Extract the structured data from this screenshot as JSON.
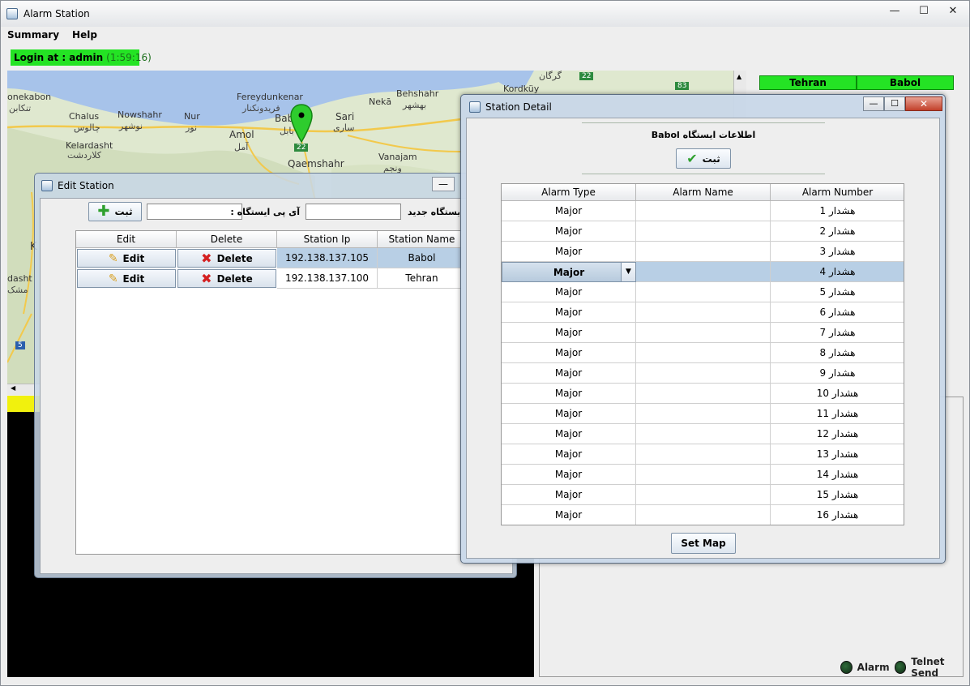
{
  "window": {
    "title": "Alarm Station",
    "controls": {
      "minimize": "—",
      "maximize": "☐",
      "close": "✕"
    }
  },
  "menu": {
    "items": [
      "Summary",
      "Help"
    ]
  },
  "login": {
    "text": "Login at : admin",
    "timer": "(1:59:16)"
  },
  "map": {
    "labels": [
      {
        "text": "onekabon"
      },
      {
        "text": "تنکابن"
      },
      {
        "text": "Chalus"
      },
      {
        "text": "چالوس"
      },
      {
        "text": "Nowshahr"
      },
      {
        "text": "نوشهر"
      },
      {
        "text": "Nur"
      },
      {
        "text": "نور"
      },
      {
        "text": "Kelardasht"
      },
      {
        "text": "کلاردشت"
      },
      {
        "text": "Fereydunkenar"
      },
      {
        "text": "فریدونکنار"
      },
      {
        "text": "Amol"
      },
      {
        "text": "آمل"
      },
      {
        "text": "Bab"
      },
      {
        "text": "بابل"
      },
      {
        "text": "Sari"
      },
      {
        "text": "ساری"
      },
      {
        "text": "Nekā"
      },
      {
        "text": "Behshahr"
      },
      {
        "text": "بهشهر"
      },
      {
        "text": "Qaemshahr"
      },
      {
        "text": "Vanajam"
      },
      {
        "text": "ونجم"
      },
      {
        "text": "گرگان"
      },
      {
        "text": "Kordküy"
      },
      {
        "text": "dasht"
      },
      {
        "text": "مشک"
      },
      {
        "text": "K"
      }
    ],
    "road_shields": [
      "22",
      "22",
      "83",
      "5"
    ]
  },
  "stations": {
    "badges": [
      "Tehran",
      "Babol"
    ]
  },
  "status": {
    "alarm_label": "Alarm",
    "telnet_label": "Telnet Send"
  },
  "edit_station": {
    "title": "Edit Station",
    "minimize": "—",
    "submit_label": "ثبت",
    "ip_label": "آی پی ایستگاه :",
    "name_label": "م ایستگاه جدید :",
    "ip_value": "",
    "name_value": "",
    "columns": [
      "Edit",
      "Delete",
      "Station Ip",
      "Station Name"
    ],
    "rows": [
      {
        "edit": "Edit",
        "delete": "Delete",
        "ip": "192.138.137.105",
        "name": "Babol"
      },
      {
        "edit": "Edit",
        "delete": "Delete",
        "ip": "192.138.137.100",
        "name": "Tehran"
      }
    ]
  },
  "station_detail": {
    "title": "Station Detail",
    "controls": {
      "minimize": "—",
      "maximize": "☐",
      "close": "✕"
    },
    "heading": "اطلاعات ایستگاه Babol",
    "submit_label": "ثبت",
    "columns": [
      "Alarm Type",
      "Alarm Name",
      "Alarm Number"
    ],
    "selected_row": 3,
    "dropdown_arrow": "▼",
    "rows": [
      {
        "type": "Major",
        "name": "",
        "number": "هشدار 1"
      },
      {
        "type": "Major",
        "name": "",
        "number": "هشدار 2"
      },
      {
        "type": "Major",
        "name": "",
        "number": "هشدار 3"
      },
      {
        "type": "Major",
        "name": "",
        "number": "هشدار 4"
      },
      {
        "type": "Major",
        "name": "",
        "number": "هشدار 5"
      },
      {
        "type": "Major",
        "name": "",
        "number": "هشدار 6"
      },
      {
        "type": "Major",
        "name": "",
        "number": "هشدار 7"
      },
      {
        "type": "Major",
        "name": "",
        "number": "هشدار 8"
      },
      {
        "type": "Major",
        "name": "",
        "number": "هشدار 9"
      },
      {
        "type": "Major",
        "name": "",
        "number": "هشدار 10"
      },
      {
        "type": "Major",
        "name": "",
        "number": "هشدار 11"
      },
      {
        "type": "Major",
        "name": "",
        "number": "هشدار 12"
      },
      {
        "type": "Major",
        "name": "",
        "number": "هشدار 13"
      },
      {
        "type": "Major",
        "name": "",
        "number": "هشدار 14"
      },
      {
        "type": "Major",
        "name": "",
        "number": "هشدار 15"
      },
      {
        "type": "Major",
        "name": "",
        "number": "هشدار 16"
      }
    ],
    "set_map_label": "Set Map"
  },
  "colors": {
    "login_green": "#24e324",
    "badge_green": "#24e324",
    "selection_blue": "#b8cfe5",
    "sea_blue": "#a7c3ea",
    "delete_red": "#d42020",
    "ok_green": "#2ea02e",
    "pin_green": "#2ecc2e"
  },
  "icons": {
    "edit": "pencil-icon",
    "delete": "red-x-icon",
    "add": "green-plus-icon",
    "ok": "green-check-icon",
    "marker": "map-pin-icon"
  }
}
